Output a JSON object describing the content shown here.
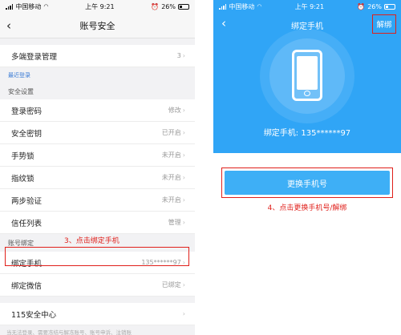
{
  "left": {
    "status": {
      "carrier": "中国移动",
      "time": "上午 9:21",
      "battery": "26%"
    },
    "nav": {
      "back_icon": "chevron-left-icon",
      "title": "账号安全"
    },
    "rows_top": [
      {
        "label": "多端登录管理",
        "value": "3"
      }
    ],
    "recent_login": "最近登录",
    "section_security": "安全设置",
    "rows_security": [
      {
        "label": "登录密码",
        "value": "修改"
      },
      {
        "label": "安全密钥",
        "value": "已开启"
      },
      {
        "label": "手势锁",
        "value": "未开启"
      },
      {
        "label": "指纹锁",
        "value": "未开启"
      },
      {
        "label": "两步验证",
        "value": "未开启"
      },
      {
        "label": "信任列表",
        "value": "管理"
      }
    ],
    "section_bind": "账号绑定",
    "step3": "3、点击绑定手机",
    "bind_phone": {
      "label": "绑定手机",
      "value": "135******97"
    },
    "bind_wechat": {
      "label": "绑定微信",
      "value": "已绑定"
    },
    "center": {
      "label": "115安全中心",
      "value": ""
    },
    "footnote": "当无法登录、需要冻结与解冻账号、账号申诉、注销账"
  },
  "right": {
    "status": {
      "carrier": "中国移动",
      "time": "上午 9:21",
      "battery": "26%"
    },
    "nav": {
      "back_icon": "chevron-left-icon",
      "title": "绑定手机",
      "unbind": "解绑"
    },
    "bound_text": "绑定手机: 135******97",
    "change_button": "更换手机号",
    "step4": "4、点击更换手机号/解绑"
  },
  "colors": {
    "accent_blue": "#30a5f6",
    "annotation_red": "#e0201b"
  }
}
